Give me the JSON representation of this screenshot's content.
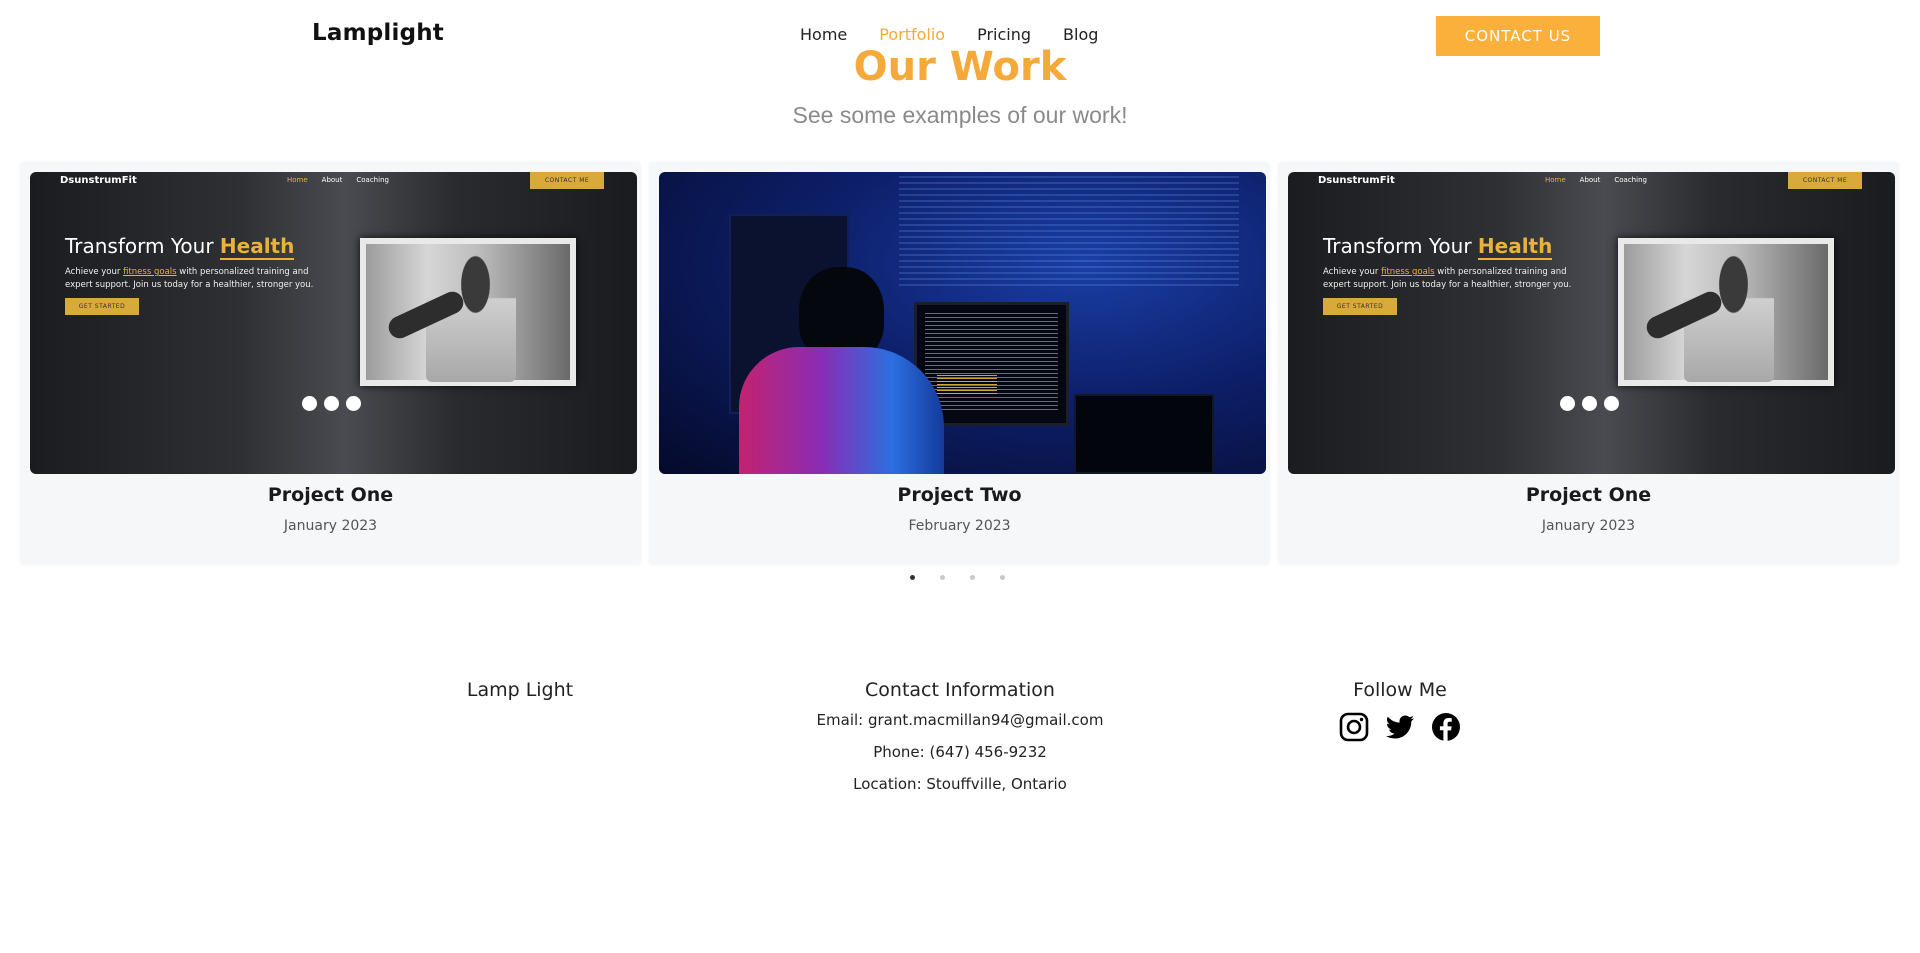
{
  "header": {
    "logo": "Lamplight",
    "nav": [
      {
        "label": "Home",
        "active": false
      },
      {
        "label": "Portfolio",
        "active": true
      },
      {
        "label": "Pricing",
        "active": false
      },
      {
        "label": "Blog",
        "active": false
      }
    ],
    "contact_label": "CONTACT US"
  },
  "section": {
    "title": "Our Work",
    "subtitle": "See some examples of our work!"
  },
  "projects": [
    {
      "title": "Project One",
      "date": "January 2023",
      "preview": {
        "brand": "DsunstrumFit",
        "nav": [
          "Home",
          "About",
          "Coaching"
        ],
        "cta_top": "CONTACT ME",
        "headline": "Transform Your",
        "headline_highlight": "Health",
        "body_pre": "Achieve your",
        "body_link": "fitness goals",
        "body_post": "with personalized training and expert support. Join us today for a healthier, stronger you.",
        "cta": "GET STARTED"
      }
    },
    {
      "title": "Project Two",
      "date": "February 2023"
    },
    {
      "title": "Project One",
      "date": "January 2023",
      "preview": {
        "brand": "DsunstrumFit",
        "nav": [
          "Home",
          "About",
          "Coaching"
        ],
        "cta_top": "CONTACT ME",
        "headline": "Transform Your",
        "headline_highlight": "Health",
        "body_pre": "Achieve your",
        "body_link": "fitness goals",
        "body_post": "with personalized training and expert support. Join us today for a healthier, stronger you.",
        "cta": "GET STARTED"
      }
    }
  ],
  "carousel": {
    "dot_count": 4,
    "active_index": 0
  },
  "footer": {
    "brand": "Lamp Light",
    "contact_heading": "Contact Information",
    "email": "Email: grant.macmillan94@gmail.com",
    "phone": "Phone: (647) 456-9232",
    "location": "Location: Stouffville, Ontario",
    "follow_heading": "Follow Me",
    "social_icons": [
      "instagram-icon",
      "twitter-icon",
      "facebook-icon"
    ]
  },
  "colors": {
    "accent": "#fbb03b",
    "accent_text": "#f6a93b"
  }
}
